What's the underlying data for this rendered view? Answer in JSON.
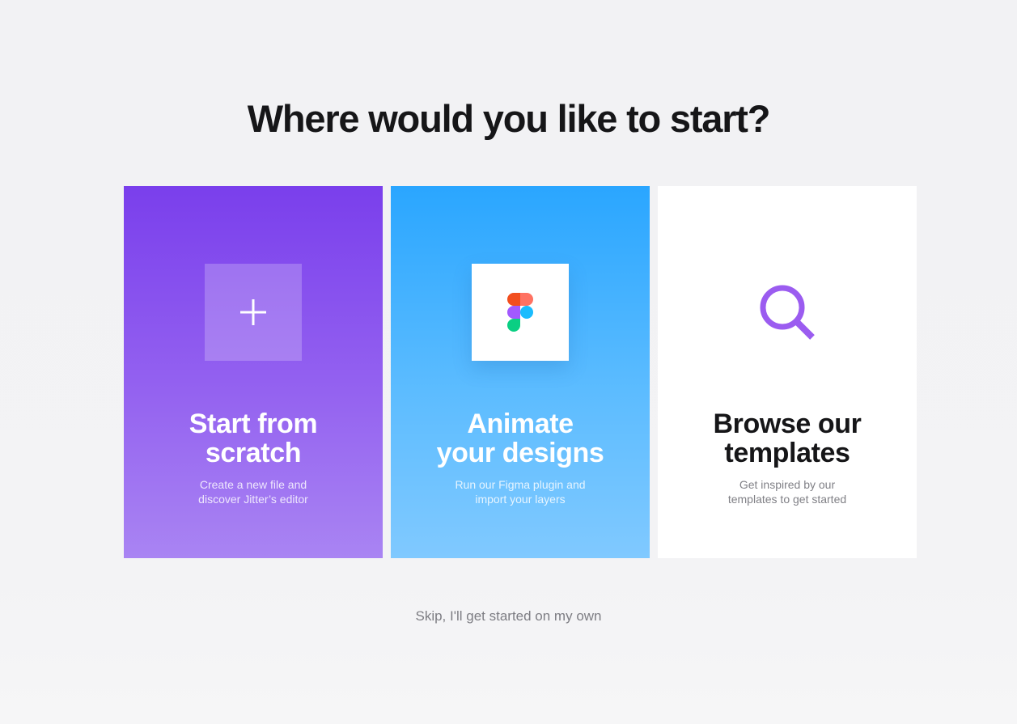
{
  "heading": "Where would you like to start?",
  "cards": [
    {
      "title": "Start from\nscratch",
      "description": "Create a new file and\ndiscover Jitter’s editor",
      "icon": "plus-icon",
      "color_top": "#7a3fec",
      "color_bottom": "#a984f3"
    },
    {
      "title": "Animate\nyour designs",
      "description": "Run our Figma plugin and\nimport your layers",
      "icon": "figma-logo-icon",
      "color_top": "#2aa6ff",
      "color_bottom": "#80c9ff"
    },
    {
      "title": "Browse our\ntemplates",
      "description": "Get inspired by our\ntemplates to get started",
      "icon": "search-icon",
      "color_top": "#ffffff",
      "color_bottom": "#ffffff"
    }
  ],
  "skip_label": "Skip, I'll get started on my own",
  "colors": {
    "accent_purple": "#9b5cf0",
    "accent_blue": "#2aa6ff",
    "text_dark": "#161618",
    "text_muted": "#7d7d83"
  }
}
